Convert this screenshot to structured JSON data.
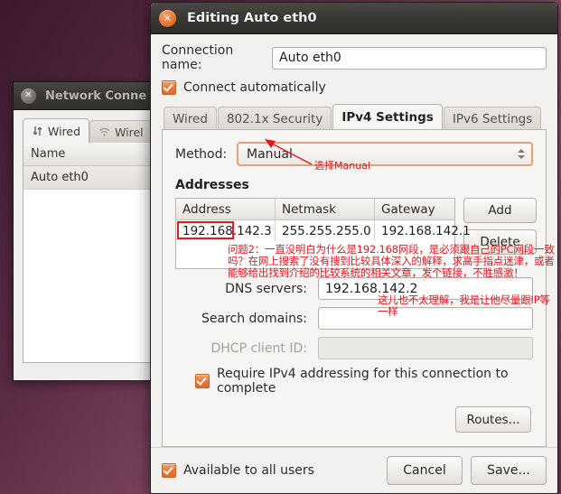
{
  "desktop": {
    "wallpaper_color": "#5f2f4a"
  },
  "background_window": {
    "title": "Network Conne",
    "close_icon": "close-icon",
    "tabs": [
      {
        "label": "Wired",
        "icon": "wired-arrows-icon",
        "active": true
      },
      {
        "label": "Wirel",
        "icon": "wireless-signal-icon",
        "active": false
      }
    ],
    "list": {
      "column_header": "Name",
      "rows": [
        {
          "name": "Auto eth0"
        }
      ]
    }
  },
  "dialog": {
    "title": "Editing Auto eth0",
    "close_icon": "close-icon",
    "connection_name": {
      "label": "Connection name:",
      "value": "Auto eth0",
      "placeholder": ""
    },
    "connect_automatically": {
      "label": "Connect automatically",
      "checked": true
    },
    "tabs": [
      {
        "label": "Wired",
        "active": false
      },
      {
        "label": "802.1x Security",
        "active": false
      },
      {
        "label": "IPv4 Settings",
        "active": true
      },
      {
        "label": "IPv6 Settings",
        "active": false
      }
    ],
    "method": {
      "label": "Method:",
      "value": "Manual"
    },
    "addresses": {
      "heading": "Addresses",
      "columns": [
        "Address",
        "Netmask",
        "Gateway"
      ],
      "rows": [
        {
          "address": "192.168.142.3",
          "netmask": "255.255.255.0",
          "gateway": "192.168.142.1"
        }
      ],
      "add_label": "Add",
      "delete_label": "Delete"
    },
    "dns_servers": {
      "label": "DNS servers:",
      "value": "192.168.142.2",
      "placeholder": ""
    },
    "search_domains": {
      "label": "Search domains:",
      "value": "",
      "placeholder": ""
    },
    "dhcp_client_id": {
      "label": "DHCP client ID:",
      "value": "",
      "placeholder": "",
      "disabled": true
    },
    "require_ipv4": {
      "label": "Require IPv4 addressing for this connection to complete",
      "checked": true
    },
    "routes_label": "Routes...",
    "available_to_all_users": {
      "label": "Available to all users",
      "checked": true
    },
    "cancel_label": "Cancel",
    "save_label": "Save..."
  },
  "annotations": {
    "color": "#e8151b",
    "method_note": "选择Manual",
    "address_note": "问题2：一直没明白为什么是192.168网段，是必须跟自己的PC网段一致吗？在网上搜索了没有搜到比较具体深入的解释，求高手指点迷津，或者能够给出找到介绍的比较系统的相关文章，发个链接，不胜感激！",
    "dns_note": "这儿也不太理解，我是让他尽量跟IP等一样"
  }
}
